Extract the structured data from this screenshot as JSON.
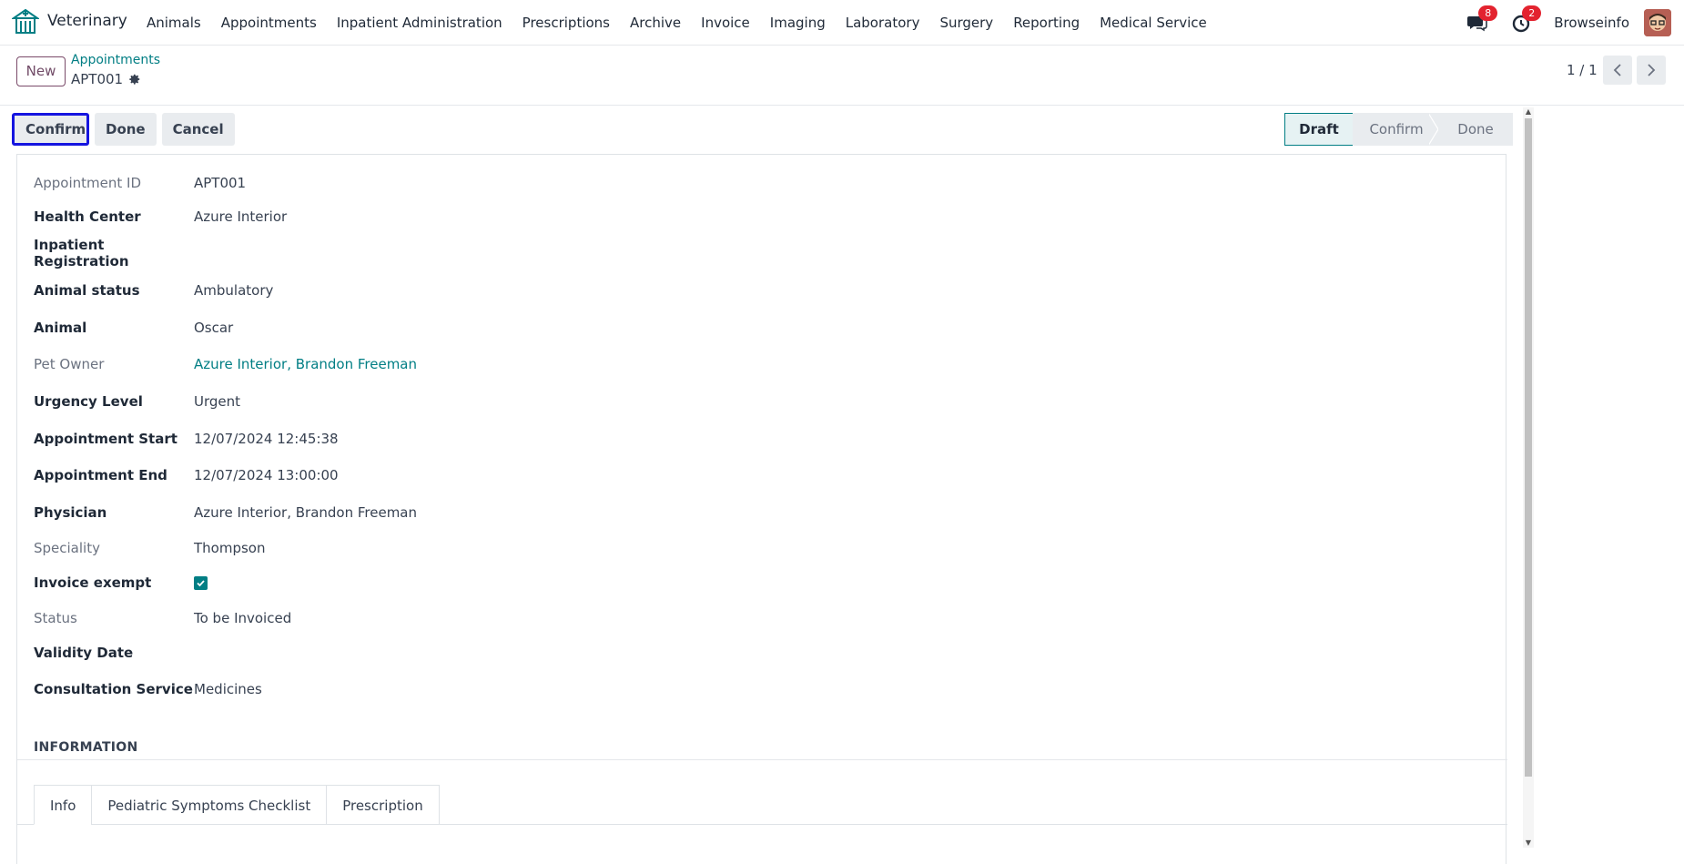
{
  "navbar": {
    "app_name": "Veterinary",
    "menu": [
      "Animals",
      "Appointments",
      "Inpatient Administration",
      "Prescriptions",
      "Archive",
      "Invoice",
      "Imaging",
      "Laboratory",
      "Surgery",
      "Reporting",
      "Medical Service"
    ],
    "messages_count": "8",
    "activities_count": "2",
    "company": "Browseinfo"
  },
  "control_panel": {
    "new_label": "New",
    "breadcrumb": "Appointments",
    "record": "APT001",
    "pager": "1 / 1"
  },
  "statusbar": {
    "buttons": [
      "Confirm",
      "Done",
      "Cancel"
    ],
    "stages": [
      "Draft",
      "Confirm",
      "Done"
    ],
    "active_stage": "Draft"
  },
  "form": {
    "fields": [
      {
        "label": "Appointment ID",
        "value": "APT001"
      },
      {
        "label": "Health Center",
        "value": "Azure Interior"
      },
      {
        "label": "Inpatient Registration",
        "value": ""
      },
      {
        "label": "Animal status",
        "value": "Ambulatory"
      },
      {
        "label": "Animal",
        "value": "Oscar"
      },
      {
        "label": "Pet Owner",
        "value": "Azure Interior, Brandon Freeman"
      },
      {
        "label": "Urgency Level",
        "value": "Urgent"
      },
      {
        "label": "Appointment Start",
        "value": "12/07/2024 12:45:38"
      },
      {
        "label": "Appointment End",
        "value": "12/07/2024 13:00:00"
      },
      {
        "label": "Physician",
        "value": "Azure Interior, Brandon Freeman"
      },
      {
        "label": "Speciality",
        "value": "Thompson"
      },
      {
        "label": "Invoice exempt",
        "value": "checked"
      },
      {
        "label": "Status",
        "value": "To be Invoiced"
      },
      {
        "label": "Validity Date",
        "value": ""
      },
      {
        "label": "Consultation Service",
        "value": "Medicines"
      }
    ],
    "section_title": "INFORMATION",
    "tabs": [
      "Info",
      "Pediatric Symptoms Checklist",
      "Prescription"
    ]
  },
  "colors": {
    "accent": "#017e84",
    "brand": "#714b67",
    "badge": "#e3232f",
    "highlight": "#1515e0"
  }
}
